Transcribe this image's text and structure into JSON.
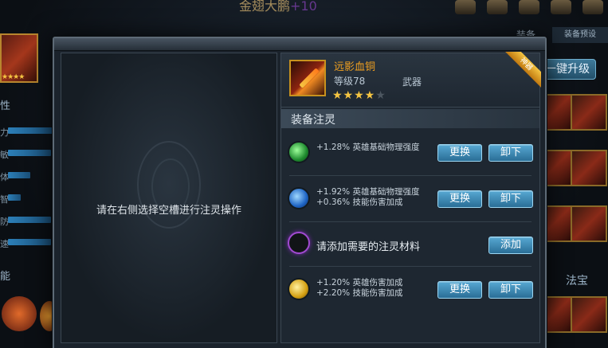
{
  "background": {
    "title": "金翅大鹏",
    "title_plus": "+10",
    "left_caption": "性",
    "left_labels": [
      "力",
      "敏",
      "体",
      "智",
      "防",
      "速"
    ],
    "skill_caption": "能",
    "tab_equipment": "装备",
    "tab_preset": "装备预设",
    "upgrade_button": "一键升级",
    "fabao_title": "法宝"
  },
  "left_pane": {
    "hint": "请在右侧选择空槽进行注灵操作"
  },
  "item": {
    "name": "远影血铜",
    "level": "等级78",
    "type": "武器",
    "stars": "★★★★",
    "empty_star": "★",
    "ribbon": "神器"
  },
  "section": {
    "title": "装备注灵"
  },
  "slots": [
    {
      "orb": "green-orb-icon",
      "lines": [
        "+1.28% 英雄基础物理强度"
      ],
      "replace_label": "更换",
      "remove_label": "卸下"
    },
    {
      "orb": "blue-orb-icon",
      "lines": [
        "+1.92% 英雄基础物理强度",
        "+0.36% 技能伤害加成"
      ],
      "replace_label": "更换",
      "remove_label": "卸下"
    },
    {
      "orb": "empty-orb-icon",
      "empty_text": "请添加需要的注灵材料",
      "add_label": "添加"
    },
    {
      "orb": "yellow-orb-icon",
      "lines": [
        "+1.20% 英雄伤害加成",
        "+2.20% 技能伤害加成"
      ],
      "replace_label": "更换",
      "remove_label": "卸下"
    }
  ],
  "colors": {
    "item_name": "#f0a020",
    "button": "#3a86b4",
    "star": "#f5c542"
  }
}
